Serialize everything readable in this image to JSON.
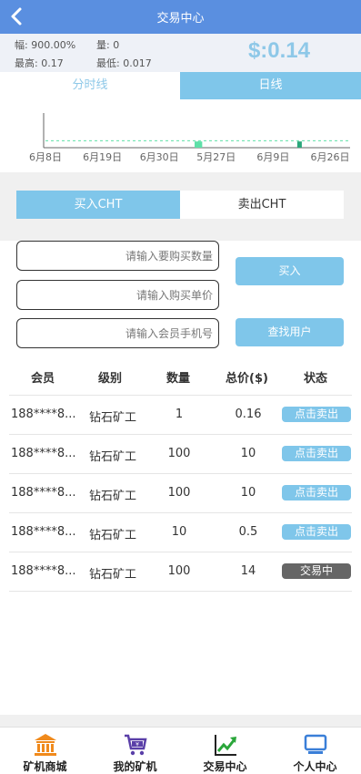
{
  "header": {
    "title": "交易中心",
    "back_icon": "chevron-left-icon"
  },
  "stats": {
    "change": "幅: 900.00%",
    "volume": "量: 0",
    "high": "最高: 0.17",
    "low": "最低: 0.017",
    "price": "$:0.14"
  },
  "chart_tabs": [
    {
      "label": "分时线"
    },
    {
      "label": "日线"
    }
  ],
  "chart_data": {
    "type": "bar",
    "x_tick_labels": [
      "6月8日",
      "6月19日",
      "6月30日",
      "5月27日",
      "6月9日",
      "6月26日"
    ],
    "bars": [
      {
        "position": 0.5,
        "value": 0.3,
        "color": "#5ee0a8"
      },
      {
        "position": 0.51,
        "value": 0.3,
        "color": "#5ee0a8"
      },
      {
        "position": 0.835,
        "value": 0.3,
        "color": "#2aa67a"
      }
    ],
    "baseline": 0.1,
    "dashed_line_color": "#5ee0a8"
  },
  "trade_tabs": [
    {
      "label": "买入CHT"
    },
    {
      "label": "卖出CHT"
    }
  ],
  "form": {
    "quantity_placeholder": "请输入要购买数量",
    "price_placeholder": "请输入购买单价",
    "phone_placeholder": "请输入会员手机号",
    "buy_label": "买入",
    "find_label": "查找用户"
  },
  "table": {
    "headers": [
      "会员",
      "级别",
      "数量",
      "总价($)",
      "状态"
    ],
    "rows": [
      {
        "member": "188****8...",
        "level": "钻石矿工",
        "qty": "1",
        "total": "0.16",
        "status": "点击卖出",
        "dark": false
      },
      {
        "member": "188****8...",
        "level": "钻石矿工",
        "qty": "100",
        "total": "10",
        "status": "点击卖出",
        "dark": false
      },
      {
        "member": "188****8...",
        "level": "钻石矿工",
        "qty": "100",
        "total": "10",
        "status": "点击卖出",
        "dark": false
      },
      {
        "member": "188****8...",
        "level": "钻石矿工",
        "qty": "10",
        "total": "0.5",
        "status": "点击卖出",
        "dark": false
      },
      {
        "member": "188****8...",
        "level": "钻石矿工",
        "qty": "100",
        "total": "14",
        "status": "交易中",
        "dark": true
      }
    ]
  },
  "footer": {
    "items": [
      {
        "label": "矿机商城",
        "icon": "bank-icon",
        "color": "#f08a1c"
      },
      {
        "label": "我的矿机",
        "icon": "cart-icon",
        "color": "#5a3fa8"
      },
      {
        "label": "交易中心",
        "icon": "trend-chart-icon",
        "color": "#2aa63a"
      },
      {
        "label": "个人中心",
        "icon": "monitor-icon",
        "color": "#3a7fd8"
      }
    ]
  }
}
